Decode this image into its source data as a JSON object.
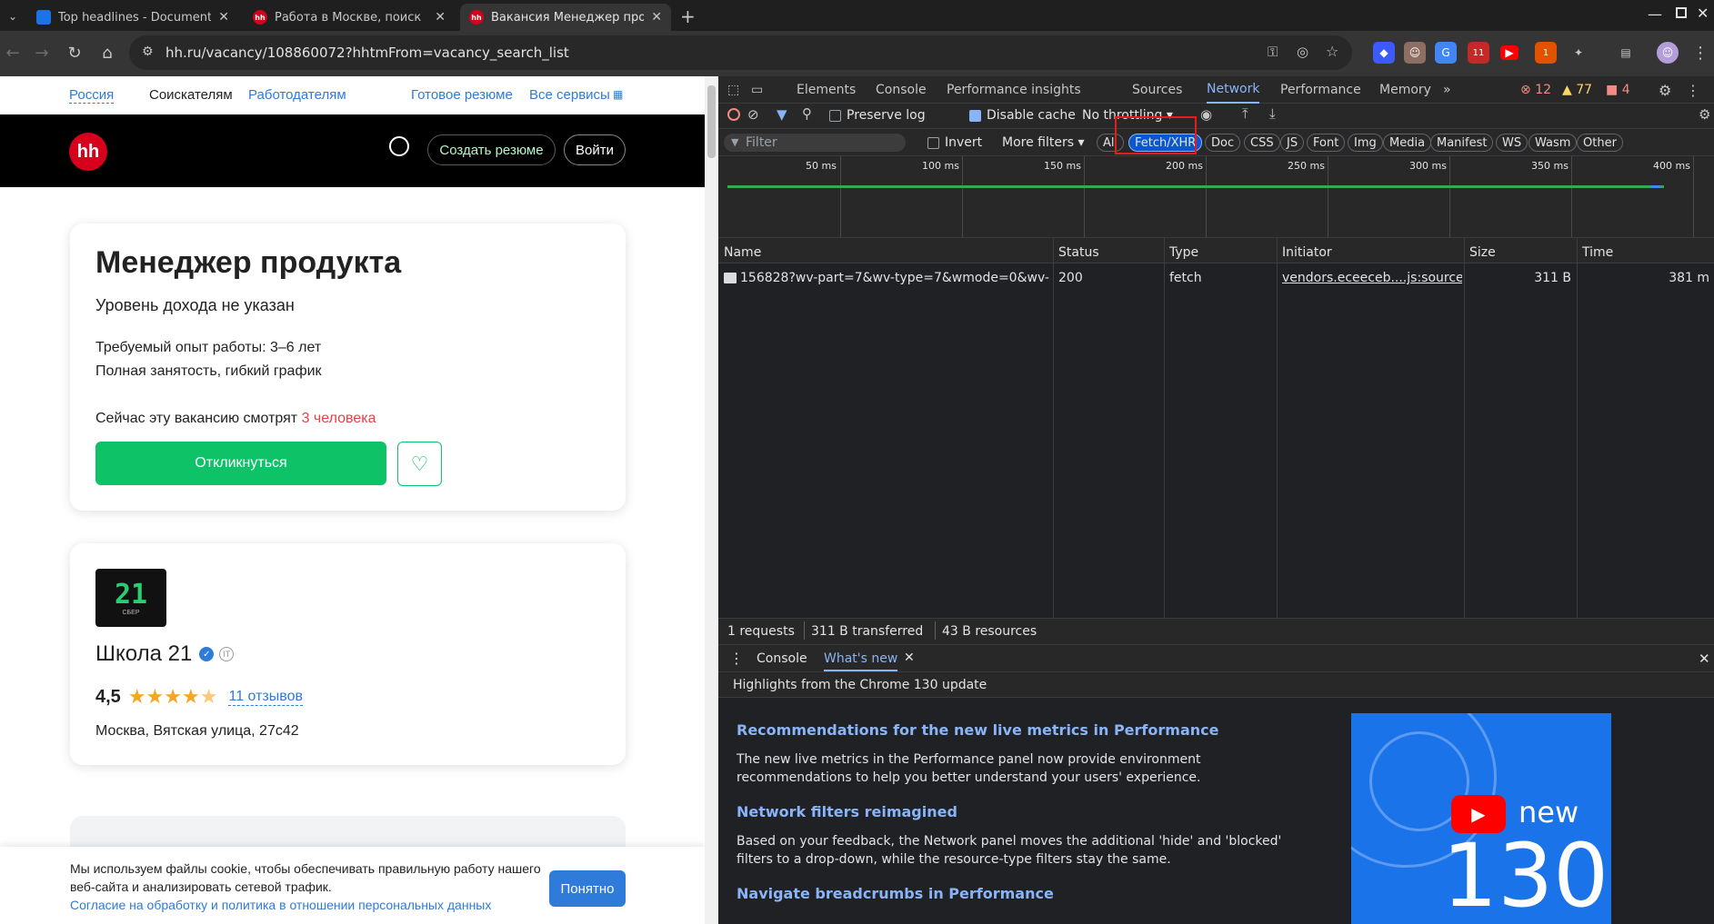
{
  "browser": {
    "tabs": [
      {
        "title": "Top headlines - Documenta",
        "active": false
      },
      {
        "title": "Работа в Москве, поиск",
        "active": false
      },
      {
        "title": "Вакансия Менеджер про",
        "active": true
      }
    ],
    "new_tab": "+",
    "url": "hh.ru/vacancy/108860072?hhtmFrom=vacancy_search_list",
    "ext_badges": {
      "mail": "11",
      "coin": "1"
    }
  },
  "site": {
    "toplinks": {
      "region": "Россия",
      "seekers": "Соискателям",
      "employers": "Работодателям",
      "resume": "Готовое резюме",
      "services": "Все сервисы"
    },
    "logo": "hh",
    "create_resume": "Создать резюме",
    "login": "Войти",
    "vacancy": {
      "title": "Менеджер продукта",
      "salary": "Уровень дохода не указан",
      "experience": "Требуемый опыт работы: 3–6 лет",
      "schedule": "Полная занятость, гибкий график",
      "viewers_prefix": "Сейчас эту вакансию смотрят ",
      "viewers_count": "3 человека",
      "apply": "Откликнуться"
    },
    "company": {
      "logo_text": "21",
      "logo_sub": "СБЕР",
      "name": "Школа 21",
      "rating": "4,5",
      "stars": 4.5,
      "reviews": "11 отзывов",
      "address": "Москва, Вятская улица, 27с42"
    },
    "cookie": {
      "text": "Мы используем файлы cookie, чтобы обеспечивать правильную работу нашего веб-сайта и анализировать сетевой трафик.",
      "link": "Согласие на обработку и политика в отношении персональных данных",
      "ok": "Понятно"
    }
  },
  "devtools": {
    "tabs": [
      "Elements",
      "Console",
      "Performance insights",
      "Sources",
      "Network",
      "Performance",
      "Memory"
    ],
    "active_tab": "Network",
    "counts": {
      "errors": "12",
      "warnings": "77",
      "issues": "4"
    },
    "toolbar": {
      "preserve_log": "Preserve log",
      "disable_cache": "Disable cache",
      "throttling": "No throttling"
    },
    "filter": {
      "placeholder": "Filter",
      "invert": "Invert",
      "more": "More filters"
    },
    "types": [
      "All",
      "Fetch/XHR",
      "Doc",
      "CSS",
      "JS",
      "Font",
      "Img",
      "Media",
      "Manifest",
      "WS",
      "Wasm",
      "Other"
    ],
    "active_type": "Fetch/XHR",
    "timeline_ticks": [
      "50 ms",
      "100 ms",
      "150 ms",
      "200 ms",
      "250 ms",
      "300 ms",
      "350 ms",
      "400 ms"
    ],
    "columns": [
      "Name",
      "Status",
      "Type",
      "Initiator",
      "Size",
      "Time"
    ],
    "rows": [
      {
        "name": "156828?wv-part=7&wv-type=7&wmode=0&wv-...",
        "status": "200",
        "type": "fetch",
        "initiator": "vendors.eceeceb....js:sourcem",
        "size": "311 B",
        "time": "381 m"
      }
    ],
    "summary": {
      "requests": "1 requests",
      "transferred": "311 B transferred",
      "resources": "43 B resources"
    },
    "drawer": {
      "tabs": [
        "Console",
        "What's new"
      ],
      "active": "What's new",
      "highlights": "Highlights from the Chrome 130 update",
      "items": [
        {
          "title": "Recommendations for the new live metrics in Performance",
          "body": "The new live metrics in the Performance panel now provide environment recommendations to help you better understand your users' experience."
        },
        {
          "title": "Network filters reimagined",
          "body": "Based on your feedback, the Network panel moves the additional 'hide' and 'blocked' filters to a drop-down, while the resource-type filters stay the same."
        },
        {
          "title": "Navigate breadcrumbs in Performance",
          "body": ""
        }
      ],
      "promo_new": "new",
      "promo_num": "130"
    }
  },
  "colors": {
    "hh_red": "#d6001c",
    "green": "#0dc267",
    "link_blue": "#2f7bd9",
    "dt_blue": "#8ab4f8",
    "highlight_red": "#e51c1c"
  }
}
